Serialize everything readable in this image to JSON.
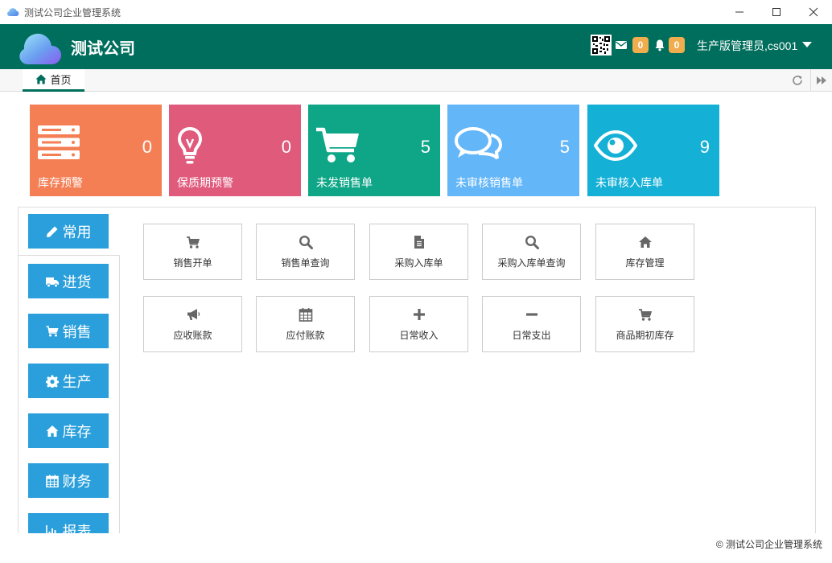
{
  "window": {
    "title": "测试公司企业管理系统"
  },
  "header": {
    "company_name": "测试公司",
    "mail_count": "0",
    "notice_count": "0",
    "user_label": "生产版管理员,cs001"
  },
  "tabs": [
    {
      "label": "首页"
    }
  ],
  "tiles": [
    {
      "label": "库存预警",
      "value": "0",
      "color": "#f47f55",
      "icon": "server-icon"
    },
    {
      "label": "保质期预警",
      "value": "0",
      "color": "#e05a7c",
      "icon": "lightbulb-icon"
    },
    {
      "label": "未发销售单",
      "value": "5",
      "color": "#0ea687",
      "icon": "cart-icon"
    },
    {
      "label": "未审核销售单",
      "value": "5",
      "color": "#63b6f8",
      "icon": "comments-icon"
    },
    {
      "label": "未审核入库单",
      "value": "9",
      "color": "#14b0d6",
      "icon": "eye-icon"
    }
  ],
  "sidebar": {
    "items": [
      {
        "label": "常用",
        "icon": "pencil-icon"
      },
      {
        "label": "进货",
        "icon": "truck-icon"
      },
      {
        "label": "销售",
        "icon": "cart-icon"
      },
      {
        "label": "生产",
        "icon": "gear-icon"
      },
      {
        "label": "库存",
        "icon": "home-icon"
      },
      {
        "label": "财务",
        "icon": "calendar-icon"
      },
      {
        "label": "报表",
        "icon": "bar-chart-icon"
      }
    ]
  },
  "functions": [
    {
      "label": "销售开单",
      "icon": "cart-icon"
    },
    {
      "label": "销售单查询",
      "icon": "search-icon"
    },
    {
      "label": "采购入库单",
      "icon": "file-icon"
    },
    {
      "label": "采购入库单查询",
      "icon": "search-icon"
    },
    {
      "label": "库存管理",
      "icon": "home-icon"
    },
    {
      "label": "应收账款",
      "icon": "megaphone-icon"
    },
    {
      "label": "应付账款",
      "icon": "calendar-icon"
    },
    {
      "label": "日常收入",
      "icon": "plus-icon"
    },
    {
      "label": "日常支出",
      "icon": "minus-icon"
    },
    {
      "label": "商品期初库存",
      "icon": "cart-icon"
    }
  ],
  "footer": {
    "copyright": "© 测试公司企业管理系统"
  },
  "colors": {
    "header_bg": "#006e5c",
    "nav_bg": "#2a9fdb",
    "badge": "#f0ad4e"
  }
}
